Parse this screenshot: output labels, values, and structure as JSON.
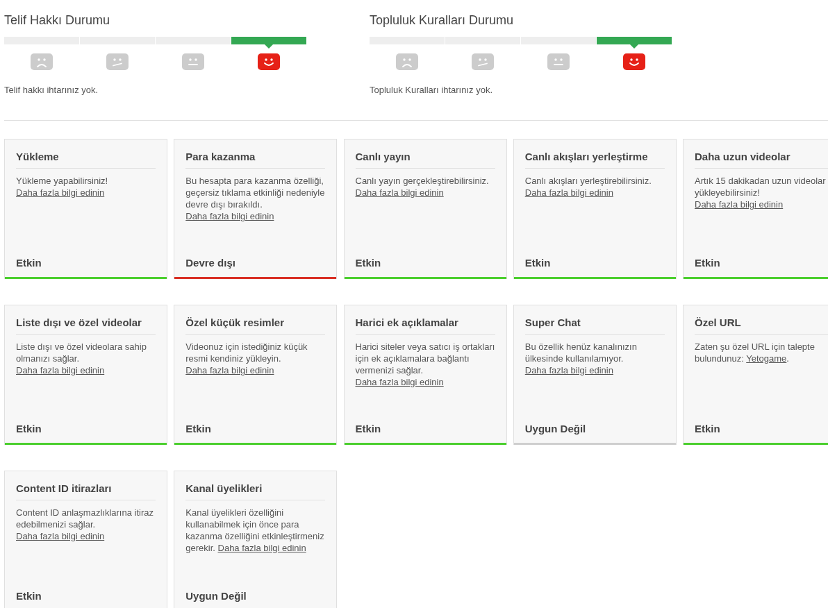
{
  "strike_panels": [
    {
      "title": "Telif Hakkı Durumu",
      "levels": [
        {
          "kind": "sad",
          "selected": false
        },
        {
          "kind": "uneasy",
          "selected": false
        },
        {
          "kind": "neutral",
          "selected": false
        },
        {
          "kind": "happy",
          "selected": true
        }
      ],
      "message": "Telif hakkı ihtarınız yok."
    },
    {
      "title": "Topluluk Kuralları Durumu",
      "levels": [
        {
          "kind": "sad",
          "selected": false
        },
        {
          "kind": "uneasy",
          "selected": false
        },
        {
          "kind": "neutral",
          "selected": false
        },
        {
          "kind": "happy",
          "selected": true
        }
      ],
      "message": "Topluluk Kuralları ihtarınız yok."
    }
  ],
  "features": [
    {
      "title": "Yükleme",
      "description": "Yükleme yapabilirsiniz!",
      "link": "Daha fazla bilgi edinin",
      "status": "Etkin",
      "color": "#4ccf2f"
    },
    {
      "title": "Para kazanma",
      "description": "Bu hesapta para kazanma özelliği, geçersiz tıklama etkinliği nedeniyle devre dışı bırakıldı.",
      "link": "Daha fazla bilgi edinin",
      "status": "Devre dışı",
      "color": "#d93025"
    },
    {
      "title": "Canlı yayın",
      "description": "Canlı yayın gerçekleştirebilirsiniz.",
      "link": "Daha fazla bilgi edinin",
      "status": "Etkin",
      "color": "#4ccf2f"
    },
    {
      "title": "Canlı akışları yerleştirme",
      "description": "Canlı akışları yerleştirebilirsiniz.",
      "link": "Daha fazla bilgi edinin",
      "status": "Etkin",
      "color": "#4ccf2f"
    },
    {
      "title": "Daha uzun videolar",
      "description": "Artık 15 dakikadan uzun videolar yükleyebilirsiniz!",
      "link": "Daha fazla bilgi edinin",
      "status": "Etkin",
      "color": "#4ccf2f"
    },
    {
      "title": "Liste dışı ve özel videolar",
      "description": "Liste dışı ve özel videolara sahip olmanızı sağlar.",
      "link": "Daha fazla bilgi edinin",
      "status": "Etkin",
      "color": "#4ccf2f"
    },
    {
      "title": "Özel küçük resimler",
      "description": "Videonuz için istediğiniz küçük resmi kendiniz yükleyin.",
      "link": "Daha fazla bilgi edinin",
      "status": "Etkin",
      "color": "#4ccf2f"
    },
    {
      "title": "Harici ek açıklamalar",
      "description": "Harici siteler veya satıcı iş ortakları için ek açıklamalara bağlantı vermenizi sağlar.",
      "link": "Daha fazla bilgi edinin",
      "status": "Etkin",
      "color": "#4ccf2f"
    },
    {
      "title": "Super Chat",
      "description": "Bu özellik henüz kanalınızın ülkesinde kullanılamıyor.",
      "link": "Daha fazla bilgi edinin",
      "status": "Uygun Değil",
      "color": "#cfcfcf"
    },
    {
      "title": "Özel URL",
      "description": "Zaten şu özel URL için talepte bulundunuz:",
      "link": "Yetogame",
      "after": ".",
      "status": "Etkin",
      "color": "#4ccf2f"
    },
    {
      "title": "Content ID itirazları",
      "description": "Content ID anlaşmazlıklarına itiraz edebilmenizi sağlar.",
      "link": "Daha fazla bilgi edinin",
      "status": "Etkin"
    },
    {
      "title": "Kanal üyelikleri",
      "description": "Kanal üyelikleri özelliğini kullanabilmek için önce para kazanma özelliğini etkinleştirmeniz gerekir.",
      "link": "Daha fazla bilgi edinin",
      "status": "Uygun Değil"
    }
  ]
}
